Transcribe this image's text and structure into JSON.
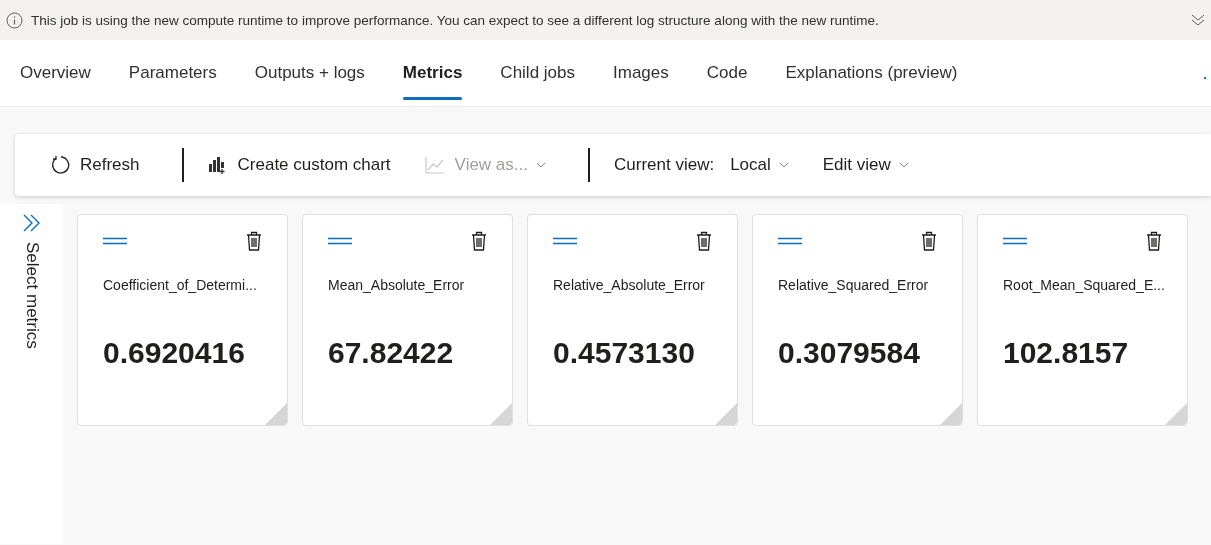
{
  "banner": {
    "text": "This job is using the new compute runtime to improve performance. You can expect to see a different log structure along with the new runtime."
  },
  "tabs": [
    {
      "label": "Overview",
      "selected": false
    },
    {
      "label": "Parameters",
      "selected": false
    },
    {
      "label": "Outputs + logs",
      "selected": false
    },
    {
      "label": "Metrics",
      "selected": true
    },
    {
      "label": "Child jobs",
      "selected": false
    },
    {
      "label": "Images",
      "selected": false
    },
    {
      "label": "Code",
      "selected": false
    },
    {
      "label": "Explanations (preview)",
      "selected": false
    }
  ],
  "toolbar": {
    "items": [
      {
        "kind": "button",
        "label": "Refresh",
        "disabled": false
      },
      {
        "kind": "divider"
      },
      {
        "kind": "button",
        "label": "Create custom chart",
        "disabled": false
      },
      {
        "kind": "dropdown",
        "label": "View as...",
        "disabled": true
      },
      {
        "kind": "divider"
      },
      {
        "kind": "label",
        "label": "Current view:"
      },
      {
        "kind": "dropdown",
        "label": "Local",
        "disabled": false
      },
      {
        "kind": "dropdown",
        "label": "Edit view",
        "disabled": false
      }
    ]
  },
  "side_panel": {
    "label": "Select metrics"
  },
  "metrics": [
    {
      "name": "Coefficient_of_Determi...",
      "value": "0.6920416"
    },
    {
      "name": "Mean_Absolute_Error",
      "value": "67.82422"
    },
    {
      "name": "Relative_Absolute_Error",
      "value": "0.4573130"
    },
    {
      "name": "Relative_Squared_Error",
      "value": "0.3079584"
    },
    {
      "name": "Root_Mean_Squared_E...",
      "value": "102.8157"
    }
  ]
}
